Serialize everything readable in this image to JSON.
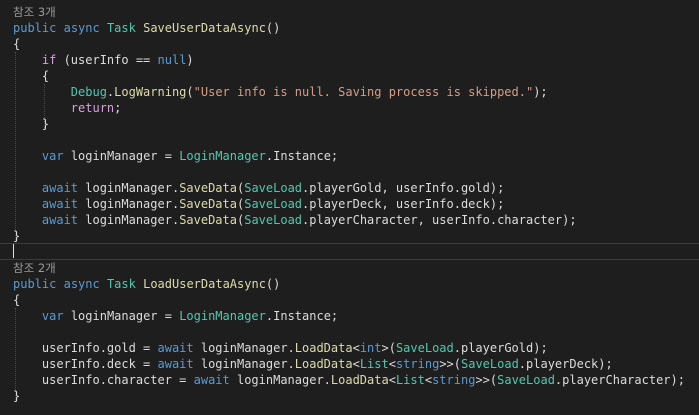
{
  "editor": {
    "colors": {
      "background": "#1e1e1e",
      "text": "#dcdcdc",
      "keyword": "#569cd6",
      "type": "#4ec9b0",
      "method": "#dcdcaa",
      "string": "#d69d85",
      "control": "#d8a0df",
      "enum_member": "#b8d7a3",
      "codelens": "#999999"
    },
    "lines": [
      {
        "codelens": "참조 3개"
      },
      {
        "tokens": [
          {
            "t": "public",
            "c": "kw"
          },
          {
            "t": " "
          },
          {
            "t": "async",
            "c": "kw"
          },
          {
            "t": " "
          },
          {
            "t": "Task",
            "c": "ty"
          },
          {
            "t": " "
          },
          {
            "t": "SaveUserDataAsync",
            "c": "mt"
          },
          {
            "t": "()"
          }
        ]
      },
      {
        "tokens": [
          {
            "t": "{"
          }
        ]
      },
      {
        "tokens": [
          {
            "t": "    "
          },
          {
            "t": "if",
            "c": "ctl"
          },
          {
            "t": " (userInfo == "
          },
          {
            "t": "null",
            "c": "kw"
          },
          {
            "t": ")"
          }
        ]
      },
      {
        "tokens": [
          {
            "t": "    {"
          }
        ]
      },
      {
        "tokens": [
          {
            "t": "        "
          },
          {
            "t": "Debug",
            "c": "ty"
          },
          {
            "t": "."
          },
          {
            "t": "LogWarning",
            "c": "mt"
          },
          {
            "t": "("
          },
          {
            "t": "\"User info is null. Saving process is skipped.\"",
            "c": "st"
          },
          {
            "t": ");"
          }
        ]
      },
      {
        "tokens": [
          {
            "t": "        "
          },
          {
            "t": "return",
            "c": "ctl"
          },
          {
            "t": ";"
          }
        ]
      },
      {
        "tokens": [
          {
            "t": "    }"
          }
        ]
      },
      {
        "tokens": []
      },
      {
        "tokens": [
          {
            "t": "    "
          },
          {
            "t": "var",
            "c": "kw"
          },
          {
            "t": " loginManager = "
          },
          {
            "t": "LoginManager",
            "c": "ty"
          },
          {
            "t": ".Instance;"
          }
        ]
      },
      {
        "tokens": []
      },
      {
        "tokens": [
          {
            "t": "    "
          },
          {
            "t": "await",
            "c": "kw"
          },
          {
            "t": " loginManager."
          },
          {
            "t": "SaveData",
            "c": "mt"
          },
          {
            "t": "("
          },
          {
            "t": "SaveLoad",
            "c": "ty"
          },
          {
            "t": ".playerGold, userInfo.gold);"
          }
        ]
      },
      {
        "tokens": [
          {
            "t": "    "
          },
          {
            "t": "await",
            "c": "kw"
          },
          {
            "t": " loginManager."
          },
          {
            "t": "SaveData",
            "c": "mt"
          },
          {
            "t": "("
          },
          {
            "t": "SaveLoad",
            "c": "ty"
          },
          {
            "t": ".playerDeck, userInfo.deck);"
          }
        ]
      },
      {
        "tokens": [
          {
            "t": "    "
          },
          {
            "t": "await",
            "c": "kw"
          },
          {
            "t": " loginManager."
          },
          {
            "t": "SaveData",
            "c": "mt"
          },
          {
            "t": "("
          },
          {
            "t": "SaveLoad",
            "c": "ty"
          },
          {
            "t": ".playerCharacter, userInfo.character);"
          }
        ]
      },
      {
        "tokens": [
          {
            "t": "}"
          }
        ]
      },
      {
        "tokens": []
      },
      {
        "codelens": "참조 2개"
      },
      {
        "tokens": [
          {
            "t": "public",
            "c": "kw"
          },
          {
            "t": " "
          },
          {
            "t": "async",
            "c": "kw"
          },
          {
            "t": " "
          },
          {
            "t": "Task",
            "c": "ty"
          },
          {
            "t": " "
          },
          {
            "t": "LoadUserDataAsync",
            "c": "mt"
          },
          {
            "t": "()"
          }
        ]
      },
      {
        "tokens": [
          {
            "t": "{"
          }
        ]
      },
      {
        "tokens": [
          {
            "t": "    "
          },
          {
            "t": "var",
            "c": "kw"
          },
          {
            "t": " loginManager = "
          },
          {
            "t": "LoginManager",
            "c": "ty"
          },
          {
            "t": ".Instance;"
          }
        ]
      },
      {
        "tokens": []
      },
      {
        "tokens": [
          {
            "t": "    userInfo.gold = "
          },
          {
            "t": "await",
            "c": "kw"
          },
          {
            "t": " loginManager."
          },
          {
            "t": "LoadData",
            "c": "mt"
          },
          {
            "t": "<"
          },
          {
            "t": "int",
            "c": "kw"
          },
          {
            "t": ">("
          },
          {
            "t": "SaveLoad",
            "c": "ty"
          },
          {
            "t": ".playerGold);"
          }
        ]
      },
      {
        "tokens": [
          {
            "t": "    userInfo.deck = "
          },
          {
            "t": "await",
            "c": "kw"
          },
          {
            "t": " loginManager."
          },
          {
            "t": "LoadData",
            "c": "mt"
          },
          {
            "t": "<"
          },
          {
            "t": "List",
            "c": "ty"
          },
          {
            "t": "<"
          },
          {
            "t": "string",
            "c": "kw"
          },
          {
            "t": ">>("
          },
          {
            "t": "SaveLoad",
            "c": "ty"
          },
          {
            "t": ".playerDeck);"
          }
        ]
      },
      {
        "tokens": [
          {
            "t": "    userInfo.character = "
          },
          {
            "t": "await",
            "c": "kw"
          },
          {
            "t": " loginManager."
          },
          {
            "t": "LoadData",
            "c": "mt"
          },
          {
            "t": "<"
          },
          {
            "t": "List",
            "c": "ty"
          },
          {
            "t": "<"
          },
          {
            "t": "string",
            "c": "kw"
          },
          {
            "t": ">>("
          },
          {
            "t": "SaveLoad",
            "c": "ty"
          },
          {
            "t": ".playerCharacter);"
          }
        ]
      },
      {
        "tokens": [
          {
            "t": "}"
          }
        ]
      }
    ]
  }
}
